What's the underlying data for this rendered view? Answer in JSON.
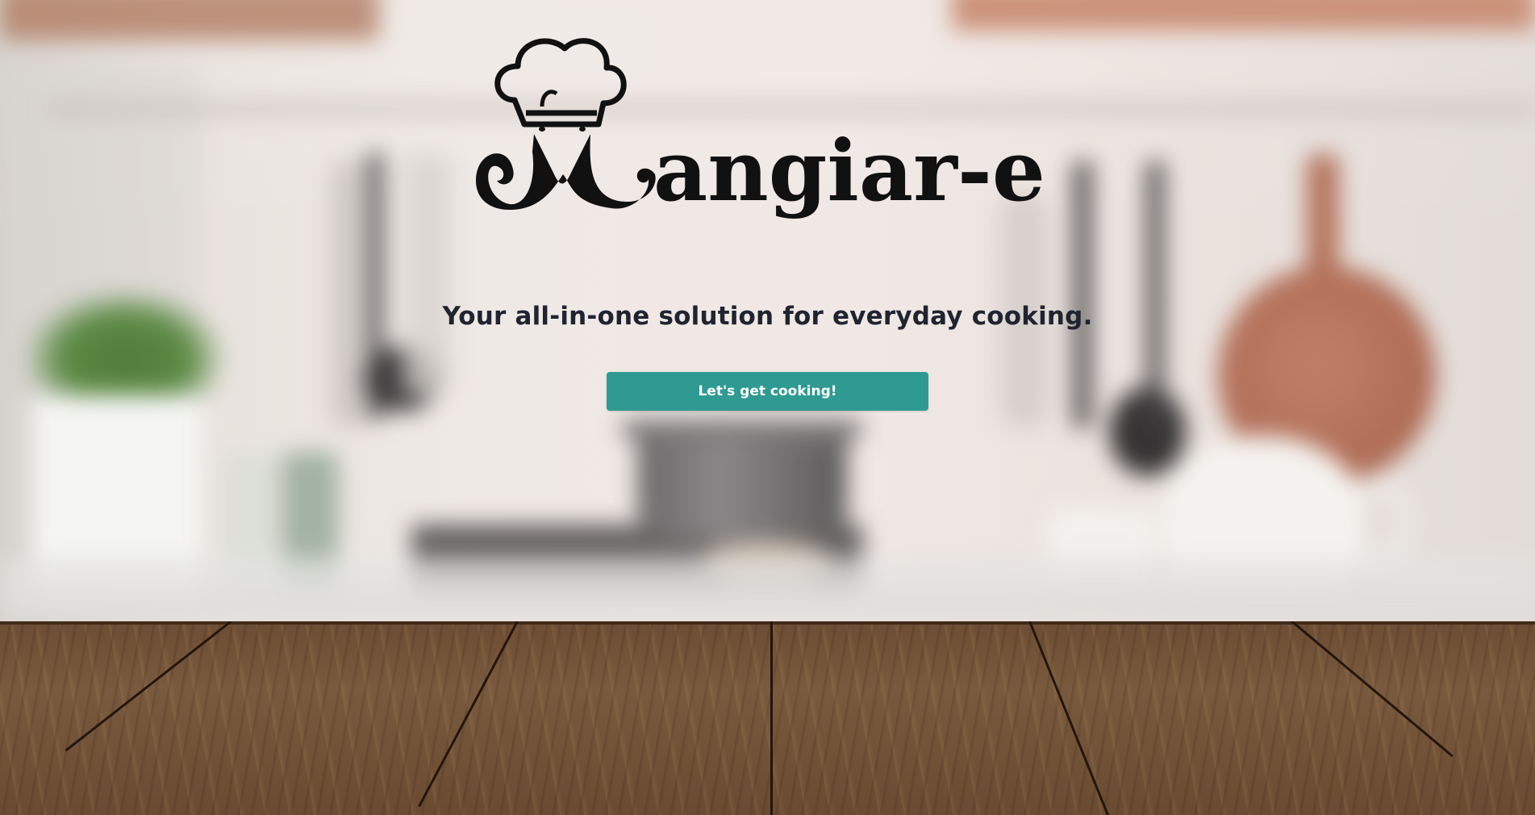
{
  "brand": {
    "name": "Mangiar-e",
    "logo_icon": "chef-hat-mustache-icon"
  },
  "hero": {
    "tagline": "Your all-in-one solution for everyday cooking.",
    "cta_label": "Let's get cooking!"
  },
  "colors": {
    "cta_background": "#2e9a92",
    "cta_text": "#ffffff",
    "tagline_text": "#1f2430",
    "logo_ink": "#111111"
  },
  "background": {
    "scene": "blurred-kitchen-with-wooden-table"
  }
}
